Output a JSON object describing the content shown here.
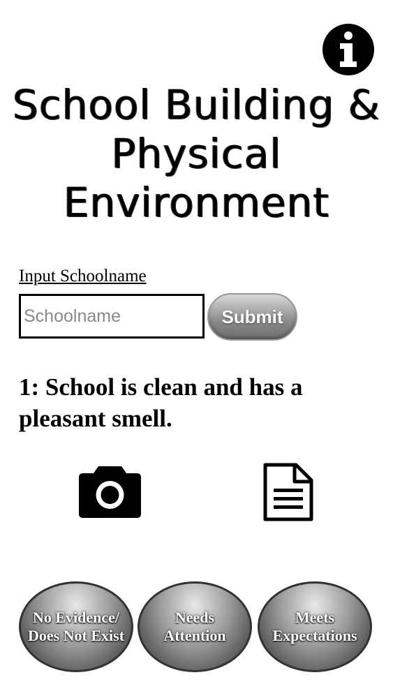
{
  "header": {
    "info_icon": "info-icon",
    "title": "School Building & Physical Environment"
  },
  "school_form": {
    "label": "Input Schoolname",
    "placeholder": "Schoolname",
    "value": "",
    "submit_label": "Submit"
  },
  "question": {
    "text": "1: School is clean and has a pleasant smell."
  },
  "attachments": {
    "camera_icon": "camera-icon",
    "document_icon": "document-icon"
  },
  "ratings": [
    {
      "label": "No Evidence/ Does Not Exist"
    },
    {
      "label": "Needs Attention"
    },
    {
      "label": "Meets Expectations"
    }
  ]
}
